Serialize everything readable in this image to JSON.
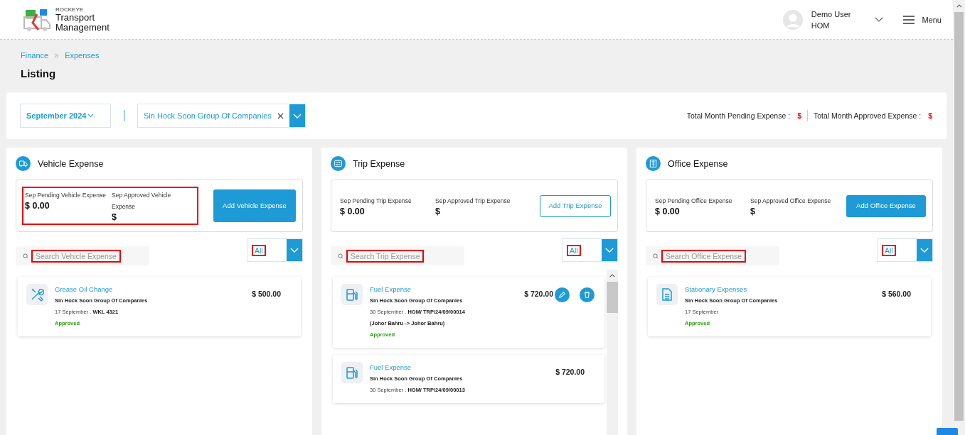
{
  "header": {
    "brand_small": "ROCKEYE",
    "brand_line1": "Transport",
    "brand_line2": "Management",
    "user_name": "Demo User",
    "user_role": "HOM",
    "menu_label": "Menu"
  },
  "breadcrumb": [
    "Finance",
    "Expenses"
  ],
  "page_title": "Listing",
  "filters": {
    "month": "September 2024",
    "company": "Sin Hock Soon Group Of Companies",
    "total_pending_label": "Total Month Pending Expense :",
    "total_pending_value": "$",
    "total_approved_label": "Total Month Approved Expense :",
    "total_approved_value": "$"
  },
  "panels": [
    {
      "kind": "vehicle",
      "title": "Vehicle Expense",
      "summary": {
        "pending_label": "Sep Pending Vehicle Expense",
        "pending_value": "$ 0.00",
        "approved_label": "Sep Approved Vehicle Expense",
        "approved_value": "$",
        "highlighted": true
      },
      "add_button": {
        "label": "Add Vehicle Expense"
      },
      "search": {
        "placeholder": "Search Vehicle Expense",
        "highlighted": true
      },
      "filter": {
        "value": "All",
        "highlighted": true
      },
      "items": [
        {
          "kind": "maintenance",
          "title": "Grease Oil Change",
          "company": "Sin Hock Soon Group Of Companies",
          "date": "17 September . ",
          "reference": "WKL 4321",
          "amount": "$ 500.00",
          "status": "Approved",
          "editable": false
        }
      ]
    },
    {
      "kind": "trip",
      "title": "Trip Expense",
      "summary": {
        "pending_label": "Sep Pending Trip Expense",
        "pending_value": "$ 0.00",
        "approved_label": "Sep Approved Trip Expense",
        "approved_value": "$",
        "highlighted": false
      },
      "add_button": {
        "label": "Add Trip Expense"
      },
      "search": {
        "placeholder": "Search Trip Expense",
        "highlighted": true
      },
      "filter": {
        "value": "All",
        "highlighted": true
      },
      "items": [
        {
          "kind": "fuel",
          "title": "Fuel Expense",
          "company": "Sin Hock Soon Group Of Companies",
          "date": "30 September . ",
          "reference": "HOM/ TRP/24/09/00014 (Johor Bahru -> Johor Bahru)",
          "amount": "$ 720.00",
          "status": "Approved",
          "editable": true
        },
        {
          "kind": "fuel",
          "title": "Fuel Expense",
          "company": "Sin Hock Soon Group Of Companies",
          "date": "30 September . ",
          "reference": "HOM/ TRP/24/09/00013",
          "amount": "$ 720.00",
          "editable": false
        }
      ]
    },
    {
      "kind": "office",
      "title": "Office Expense",
      "summary": {
        "pending_label": "Sep Pending Office Expense",
        "pending_value": "$ 0.00",
        "approved_label": "Sep Approved Office Expense",
        "approved_value": "$",
        "highlighted": false
      },
      "add_button": {
        "label": "Add Office Expense"
      },
      "search": {
        "placeholder": "Search Office Expense",
        "highlighted": true
      },
      "filter": {
        "value": "All",
        "highlighted": true
      },
      "items": [
        {
          "kind": "stationery",
          "title": "Stationary Expenses",
          "company": "Sin Hock Soon Group Of Companies",
          "date": "17 September",
          "amount": "$ 560.00",
          "status": "Approved",
          "editable": false
        }
      ]
    }
  ]
}
